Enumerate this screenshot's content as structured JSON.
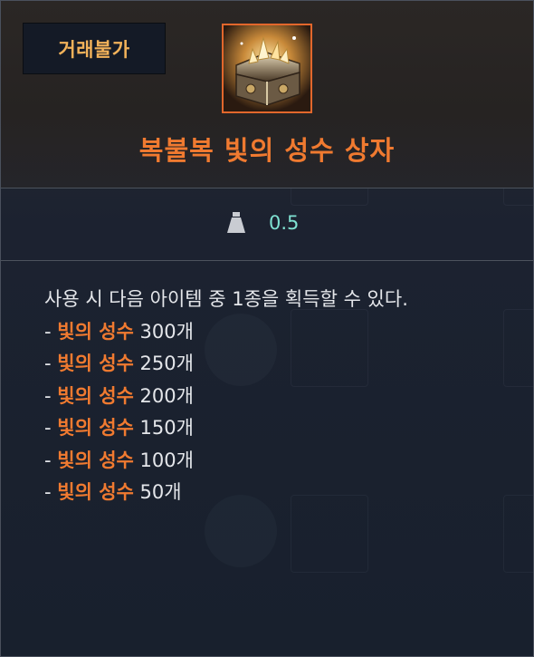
{
  "tooltip": {
    "badge_label": "거래불가",
    "item_icon": "treasure-chest-icon",
    "item_name": "복불복 빛의 성수 상자",
    "weight_icon": "weight-icon",
    "weight_value": "0.5",
    "description": "사용 시 다음 아이템 중 1종을 획득할 수 있다.",
    "rewards": [
      {
        "prefix": "- ",
        "name": "빛의 성수",
        "amount": " 300개"
      },
      {
        "prefix": "- ",
        "name": "빛의 성수",
        "amount": " 250개"
      },
      {
        "prefix": "- ",
        "name": "빛의 성수",
        "amount": " 200개"
      },
      {
        "prefix": "- ",
        "name": "빛의 성수",
        "amount": " 150개"
      },
      {
        "prefix": "- ",
        "name": "빛의 성수",
        "amount": " 100개"
      },
      {
        "prefix": "- ",
        "name": "빛의 성수",
        "amount": " 50개"
      }
    ]
  },
  "colors": {
    "item_name": "#f07a30",
    "badge_text": "#f2b25a",
    "weight_value": "#7fe2d2",
    "icon_border": "#e2672c"
  }
}
